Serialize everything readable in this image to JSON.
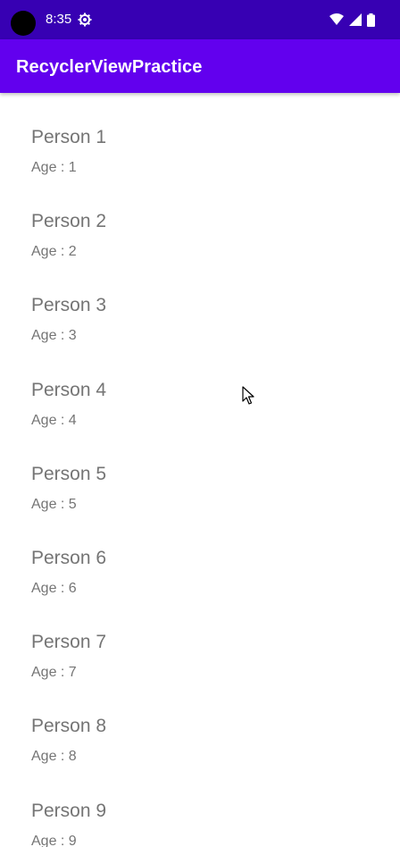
{
  "status_bar": {
    "time": "8:35",
    "icons": [
      "camera-cutout",
      "gear-icon",
      "wifi-icon",
      "signal-icon",
      "battery-icon"
    ]
  },
  "app_bar": {
    "title": "RecyclerViewPractice"
  },
  "list": {
    "items": [
      {
        "name": "Person 1",
        "age": "Age : 1"
      },
      {
        "name": "Person 2",
        "age": "Age : 2"
      },
      {
        "name": "Person 3",
        "age": "Age : 3"
      },
      {
        "name": "Person 4",
        "age": "Age : 4"
      },
      {
        "name": "Person 5",
        "age": "Age : 5"
      },
      {
        "name": "Person 6",
        "age": "Age : 6"
      },
      {
        "name": "Person 7",
        "age": "Age : 7"
      },
      {
        "name": "Person 8",
        "age": "Age : 8"
      },
      {
        "name": "Person 9",
        "age": "Age : 9"
      }
    ]
  },
  "colors": {
    "status_bar": "#3700b3",
    "app_bar": "#6200ee",
    "text_secondary": "#757575",
    "background": "#ffffff"
  }
}
